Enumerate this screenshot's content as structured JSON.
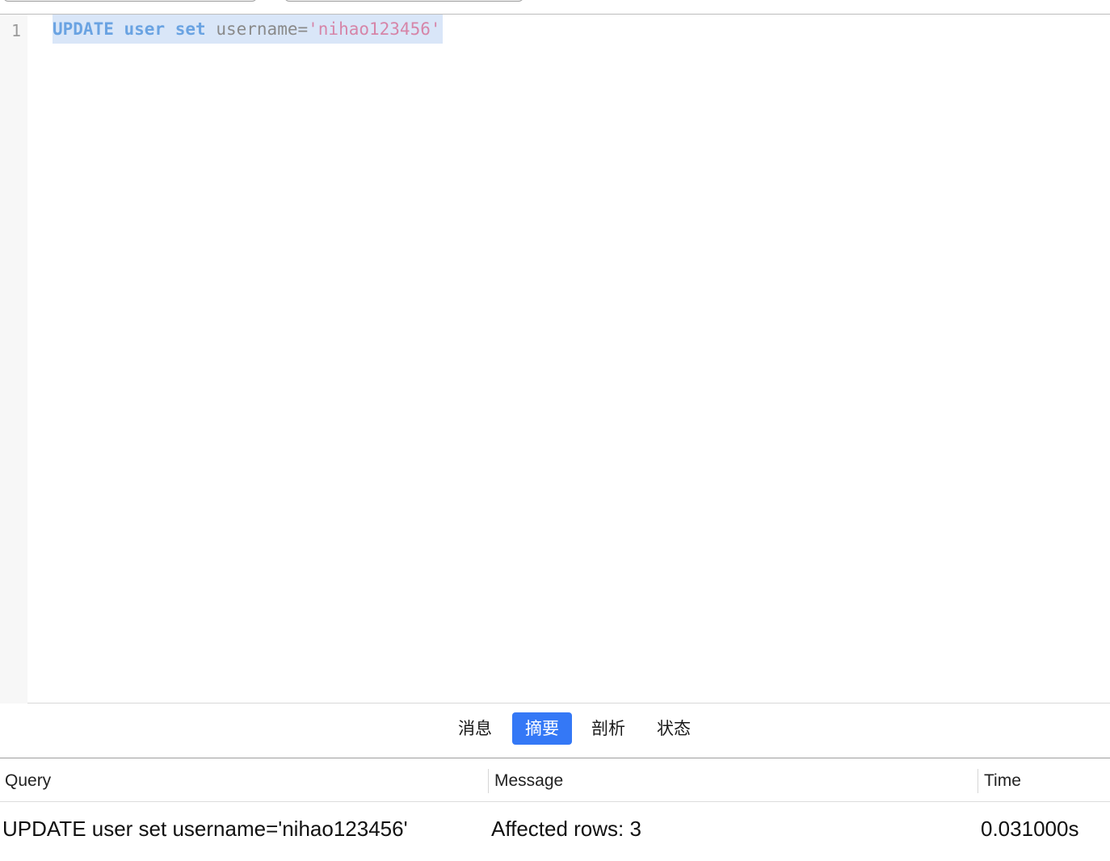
{
  "editor": {
    "line_number": "1",
    "code": {
      "kw_update": "UPDATE",
      "space1": " ",
      "kw_user": "user",
      "space2": " ",
      "kw_set": "set",
      "space3": " ",
      "identifier": "username=",
      "string": "'nihao123456'"
    }
  },
  "tabs": [
    {
      "label": "消息",
      "active": false
    },
    {
      "label": "摘要",
      "active": true
    },
    {
      "label": "剖析",
      "active": false
    },
    {
      "label": "状态",
      "active": false
    }
  ],
  "results": {
    "columns": [
      "Query",
      "Message",
      "Time"
    ],
    "rows": [
      {
        "query": "UPDATE user set username='nihao123456'",
        "message": "Affected rows: 3",
        "time": "0.031000s"
      }
    ]
  },
  "colors": {
    "active_tab": "#3478f6",
    "selection": "#d9e6f8",
    "keyword": "#6aa3e2",
    "string": "#d685a8"
  }
}
